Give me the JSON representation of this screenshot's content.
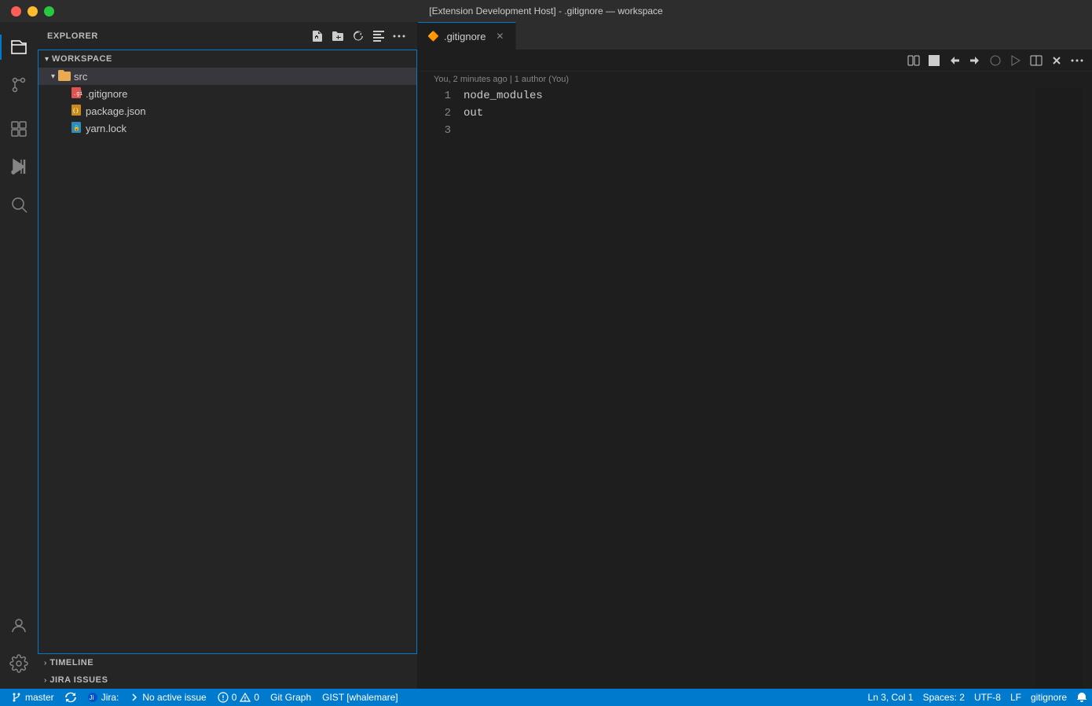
{
  "window": {
    "title": "[Extension Development Host] - .gitignore — workspace"
  },
  "activityBar": {
    "items": [
      {
        "id": "explorer",
        "icon": "files-icon",
        "label": "Explorer",
        "active": true
      },
      {
        "id": "source-control",
        "icon": "source-control-icon",
        "label": "Source Control"
      },
      {
        "id": "extensions",
        "icon": "extensions-icon",
        "label": "Extensions"
      },
      {
        "id": "run",
        "icon": "run-icon",
        "label": "Run and Debug"
      },
      {
        "id": "search",
        "icon": "search-icon",
        "label": "Search"
      }
    ],
    "bottom": [
      {
        "id": "account",
        "icon": "account-icon",
        "label": "Account"
      },
      {
        "id": "settings",
        "icon": "settings-icon",
        "label": "Settings"
      }
    ]
  },
  "sidebar": {
    "title": "EXPLORER",
    "workspace": {
      "label": "WORKSPACE",
      "collapsed": false
    },
    "files": [
      {
        "id": "src",
        "type": "folder",
        "name": "src",
        "depth": 1,
        "expanded": true
      },
      {
        "id": "gitignore",
        "type": "file-git",
        "name": ".gitignore",
        "depth": 2
      },
      {
        "id": "package",
        "type": "file-package",
        "name": "package.json",
        "depth": 2
      },
      {
        "id": "yarn",
        "type": "file-yarn",
        "name": "yarn.lock",
        "depth": 2
      }
    ],
    "panels": [
      {
        "id": "timeline",
        "label": "TIMELINE"
      },
      {
        "id": "jira",
        "label": "JIRA ISSUES"
      }
    ]
  },
  "editor": {
    "tab": {
      "icon": "🔶",
      "filename": ".gitignore",
      "subtitle": ".gitignore"
    },
    "blame": "You, 2 minutes ago | 1 author (You)",
    "lines": [
      {
        "num": 1,
        "content": "node_modules"
      },
      {
        "num": 2,
        "content": "out"
      },
      {
        "num": 3,
        "content": ""
      }
    ]
  },
  "statusBar": {
    "branch": "master",
    "syncIcon": "↻",
    "jiraIcon": "🔵",
    "jiraLabel": "Jira:",
    "noIssue": "No active issue",
    "errors": "0",
    "warnings": "0",
    "gitGraph": "Git Graph",
    "gist": "GIST [whalemare]",
    "position": "Ln 3, Col 1",
    "spaces": "Spaces: 2",
    "encoding": "UTF-8",
    "lineEnding": "LF",
    "language": "gitignore",
    "bell": "🔔"
  }
}
